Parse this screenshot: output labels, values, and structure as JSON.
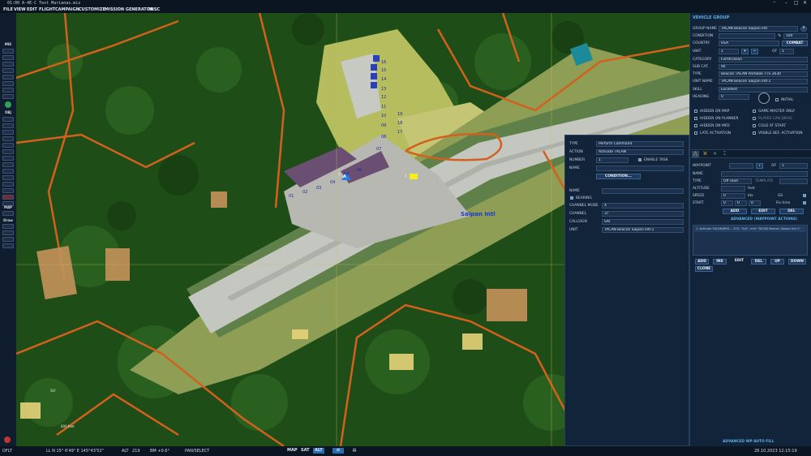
{
  "title_bar": {
    "mission": "01:00  A-4E-C Test Marianas.miz",
    "window_controls": [
      "–",
      "□",
      "✕"
    ]
  },
  "menu": [
    "FILE",
    "VIEW",
    "EDIT",
    "FLIGHT",
    "CAMPAIGN",
    "CUSTOMIZE",
    "MISSION GENERATOR",
    "MISC"
  ],
  "left_toolbar": {
    "sections": [
      "MIS",
      "OBJ",
      "MAP",
      "Draw"
    ],
    "map_btn": "Draw"
  },
  "map": {
    "airport_label": "Saipan Intl",
    "parking_spots": [
      "01",
      "02",
      "03",
      "04",
      "05",
      "06",
      "07",
      "08",
      "09",
      "10",
      "11",
      "12",
      "13",
      "14",
      "15",
      "16",
      "17",
      "18",
      "19"
    ],
    "unit_marker": "A",
    "unit_marker_badge": "1",
    "yellow_unit_badge": "1",
    "scale_label": "600 feet",
    "small_label": "SLY"
  },
  "vehicle_group": {
    "title": "VEHICLE GROUP",
    "group_name_label": "GROUP NAME",
    "group_name": "TACAN Beacon Saipan Intl",
    "help": "?",
    "condition_label": "CONDITION",
    "condition_value": "100",
    "condition_pct": "%",
    "country_label": "COUNTRY",
    "country": "USA",
    "combat_btn": "COMBAT",
    "unit_label": "UNIT",
    "unit_value": "1",
    "unit_of": "OF",
    "unit_total": "1",
    "category_label": "CATEGORY",
    "category": "Fortification",
    "subcat_label": "SUB CAT.",
    "subcat": "All",
    "type_label": "TYPE",
    "type": "Beacon TACAN Portable TTS 3030",
    "unit_name_label": "UNIT NAME",
    "unit_name": "TACAN Beacon Saipan Intl-1",
    "skill_label": "SKILL",
    "skill": "Excellent",
    "heading_label": "HEADING",
    "heading": "0",
    "initial_label": "INITIAL",
    "checkboxes": [
      {
        "label": "HIDDEN ON MAP",
        "on": false
      },
      {
        "label": "GAME MASTER ONLY",
        "on": false
      },
      {
        "label": "HIDDEN ON PLANNER",
        "on": false
      },
      {
        "label": "PLAYER CAN DRIVE",
        "on": false
      },
      {
        "label": "HIDDEN ON MFD",
        "on": false
      },
      {
        "label": "COLD AT START",
        "on": false
      },
      {
        "label": "LATE ACTIVATION",
        "on": false
      },
      {
        "label": "VISIBLE BEF. ACTIVATION",
        "on": false
      }
    ],
    "waypoint_label": "WAYPOINT",
    "wp_of": "OF",
    "wp_total": "1",
    "name_label": "NAME",
    "type_wp_label": "TYPE",
    "type_wp": "Off road",
    "template_label": "TEMPLATE",
    "altitude_label": "ALTITUDE",
    "altitude_unit": "feet",
    "speed_label": "SPEED",
    "speed_value": "0",
    "speed_unit": "kts",
    "gs_label": "GS",
    "start_label": "START",
    "start_values": [
      "0",
      "0",
      "0"
    ],
    "fix_time": "Fix time",
    "add_btn": "ADD",
    "edit_btn": "EDIT",
    "del_btn": "DEL",
    "adv_wp_actions": "ADVANCED (WAYPOINT ACTIONS)",
    "action_item": "1. Activate TACAN(BRG... 37X, \"SAI\", Unit \"TACAN Beacon Saipan Intl-1\"",
    "list_buttons": [
      "ADD",
      "INS",
      "EDIT",
      "DEL",
      "UP",
      "DOWN",
      "CLONE"
    ],
    "autofill": "ADVANCED WP AUTO FILL"
  },
  "command_panel": {
    "type_label": "TYPE",
    "type": "Perform Command",
    "action_label": "ACTION",
    "action": "Activate TACAN",
    "number_label": "NUMBER",
    "number": "1",
    "enable_task": "ENABLE TASK",
    "name_label": "NAME",
    "condition_btn": "CONDITION...",
    "name2_label": "NAME",
    "bearing": "BEARING",
    "channel_mode_label": "CHANNEL MODE",
    "channel_mode": "X",
    "channel_label": "CHANNEL",
    "channel": "37",
    "callsign_label": "CALLSIGN",
    "callsign": "SAI",
    "unit_label": "UNIT",
    "unit": "TACAN Beacon Saipan Intl-1"
  },
  "status_bar": {
    "mode": "DFLT",
    "ll": "LL  N 15° 6'49\"  E 145°43'52\"",
    "alt_label": "ALT",
    "alt": "219",
    "bm": "BM  +0.6°",
    "tool": "PAN/SELECT",
    "map_btns": [
      "MAP",
      "SAT",
      "ALT"
    ],
    "datetime": "28.10.2023  12:15:19"
  },
  "colors": {
    "accent": "#4a9ee0",
    "forest": "#1f4d18",
    "road": "#d4601e",
    "runway": "#c4c6c0"
  }
}
